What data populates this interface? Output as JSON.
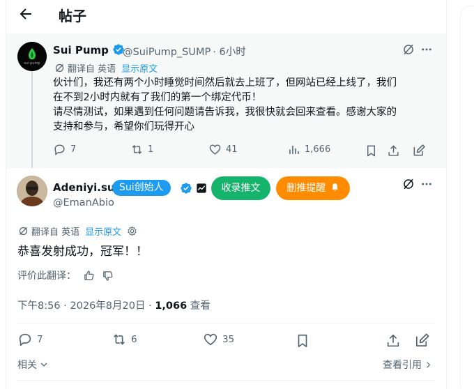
{
  "header": {
    "title": "帖子"
  },
  "quoted": {
    "author_name": "Sui Pump",
    "handle": "@SuiPump_SUMP",
    "time": "· 6小时",
    "avatar_text": "sui pump",
    "translation": {
      "prefix": "翻译自 英语",
      "show_original": "显示原文"
    },
    "body_lines": [
      "伙计们，我还有两个小时睡觉时间然后就去上班了，但网站已经上线了，我们",
      "在不到2小时内就有了我们的第一个绑定代币！",
      "请尽情测试，如果遇到任何问题请告诉我，我很快就会回来查看。感谢大家的",
      "支持和参与，希望你们玩得开心"
    ],
    "stats": {
      "replies": "7",
      "reposts": "1",
      "likes": "41",
      "views": "1,666"
    }
  },
  "post": {
    "author_name": "Adeniyi.sui",
    "role_badge": "Sui创始人",
    "handle": "@EmanAbio",
    "pill_collect": "收录推文",
    "pill_delete": "删推提醒",
    "translation": {
      "prefix": "翻译自 英语",
      "show_original": "显示原文"
    },
    "body": "恭喜发射成功，冠军！！",
    "rate_label": "评价此翻译：",
    "timestamp": "下午8:56 · 2026年8月20日 · ",
    "view_count": "1,066",
    "view_label": " 查看",
    "stats": {
      "replies": "7",
      "reposts": "6",
      "likes": "35"
    }
  },
  "footer": {
    "related": "相关",
    "view_quotes": "查看引用"
  },
  "colors": {
    "accent": "#1d9bf0",
    "green_pill": "#16b36c",
    "orange_pill": "#ff8c00",
    "muted": "#536471"
  }
}
